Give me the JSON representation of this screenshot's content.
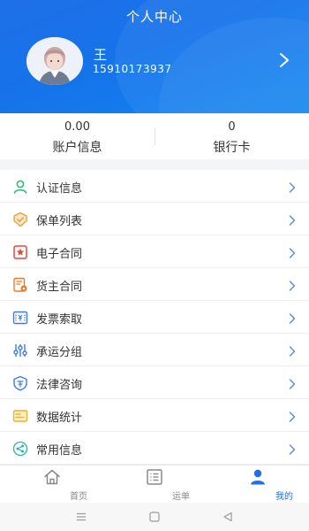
{
  "header": {
    "title": "个人中心",
    "user_name": "王",
    "user_phone": "15910173937"
  },
  "stats": [
    {
      "value": "0.00",
      "label": "账户信息"
    },
    {
      "value": "0",
      "label": "银行卡"
    }
  ],
  "menu": [
    {
      "label": "认证信息",
      "icon": "user-icon",
      "color": "#2bb673"
    },
    {
      "label": "保单列表",
      "icon": "shield-check-icon",
      "color": "#f29b2a"
    },
    {
      "label": "电子合同",
      "icon": "stamp-icon",
      "color": "#e9453f"
    },
    {
      "label": "货主合同",
      "icon": "contract-icon",
      "color": "#f07a2a"
    },
    {
      "label": "发票索取",
      "icon": "invoice-icon",
      "color": "#3f7be8"
    },
    {
      "label": "承运分组",
      "icon": "sliders-icon",
      "color": "#3f7be8"
    },
    {
      "label": "法律咨询",
      "icon": "law-shield-icon",
      "color": "#3f7be8"
    },
    {
      "label": "数据统计",
      "icon": "chart-card-icon",
      "color": "#f0b323"
    },
    {
      "label": "常用信息",
      "icon": "share-icon",
      "color": "#2bb6a5"
    }
  ],
  "tabs": [
    {
      "label": "首页",
      "icon": "home-icon"
    },
    {
      "label": "运单",
      "icon": "list-icon"
    },
    {
      "label": "我的",
      "icon": "person-icon"
    }
  ],
  "colors": {
    "accent": "#1e6fe8",
    "chevron": "#5b8fe0"
  }
}
